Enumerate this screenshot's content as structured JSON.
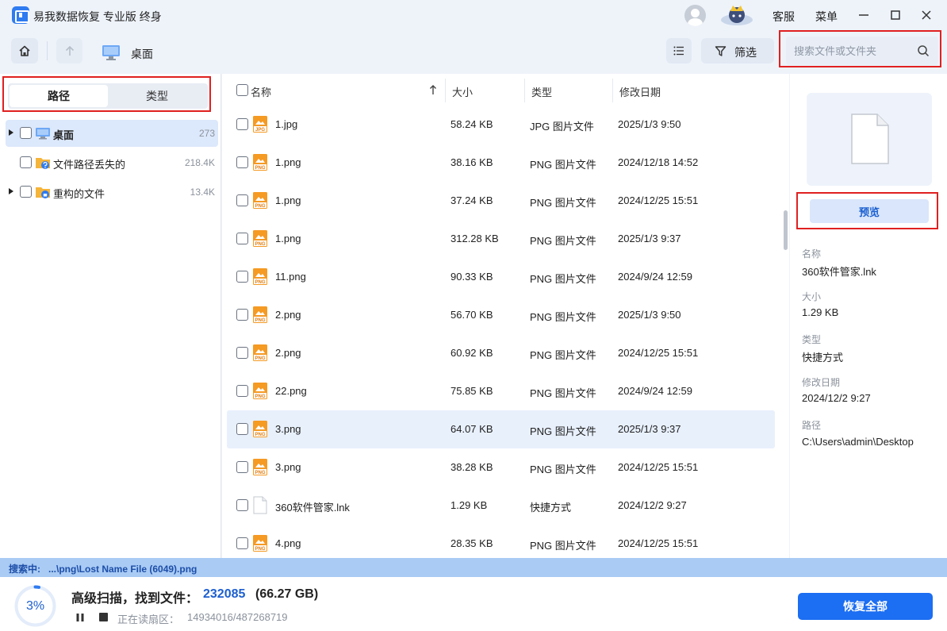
{
  "app": {
    "title": "易我数据恢复 专业版 终身",
    "service_label": "客服",
    "menu_label": "菜单"
  },
  "toolbar": {
    "breadcrumb": "桌面",
    "filter_label": "筛选",
    "search_placeholder": "搜索文件或文件夹"
  },
  "left_tabs": {
    "path": "路径",
    "type": "类型"
  },
  "tree": [
    {
      "label": "桌面",
      "count": "273",
      "expandable": true,
      "selected": true,
      "icon": "desktop-icon"
    },
    {
      "label": "文件路径丢失的",
      "count": "218.4K",
      "expandable": false,
      "selected": false,
      "icon": "folder-lost-icon"
    },
    {
      "label": "重构的文件",
      "count": "13.4K",
      "expandable": true,
      "selected": false,
      "icon": "folder-rebuilt-icon"
    }
  ],
  "columns": {
    "name": "名称",
    "size": "大小",
    "type": "类型",
    "date": "修改日期"
  },
  "files": [
    {
      "name": "1.jpg",
      "size": "58.24 KB",
      "type": "JPG 图片文件",
      "date": "2025/1/3 9:50",
      "kind": "JPG"
    },
    {
      "name": "1.png",
      "size": "38.16 KB",
      "type": "PNG 图片文件",
      "date": "2024/12/18 14:52",
      "kind": "PNG"
    },
    {
      "name": "1.png",
      "size": "37.24 KB",
      "type": "PNG 图片文件",
      "date": "2024/12/25 15:51",
      "kind": "PNG"
    },
    {
      "name": "1.png",
      "size": "312.28 KB",
      "type": "PNG 图片文件",
      "date": "2025/1/3 9:37",
      "kind": "PNG"
    },
    {
      "name": "11.png",
      "size": "90.33 KB",
      "type": "PNG 图片文件",
      "date": "2024/9/24 12:59",
      "kind": "PNG"
    },
    {
      "name": "2.png",
      "size": "56.70 KB",
      "type": "PNG 图片文件",
      "date": "2025/1/3 9:50",
      "kind": "PNG"
    },
    {
      "name": "2.png",
      "size": "60.92 KB",
      "type": "PNG 图片文件",
      "date": "2024/12/25 15:51",
      "kind": "PNG"
    },
    {
      "name": "22.png",
      "size": "75.85 KB",
      "type": "PNG 图片文件",
      "date": "2024/9/24 12:59",
      "kind": "PNG"
    },
    {
      "name": "3.png",
      "size": "64.07 KB",
      "type": "PNG 图片文件",
      "date": "2025/1/3 9:37",
      "kind": "PNG",
      "highlight": true
    },
    {
      "name": "3.png",
      "size": "38.28 KB",
      "type": "PNG 图片文件",
      "date": "2024/12/25 15:51",
      "kind": "PNG"
    },
    {
      "name": "360软件管家.lnk",
      "size": "1.29 KB",
      "type": "快捷方式",
      "date": "2024/12/2 9:27",
      "kind": "LNK"
    },
    {
      "name": "4.png",
      "size": "28.35 KB",
      "type": "PNG 图片文件",
      "date": "2024/12/25 15:51",
      "kind": "PNG"
    }
  ],
  "preview": {
    "button": "预览",
    "name_label": "名称",
    "name": "360软件管家.lnk",
    "size_label": "大小",
    "size": "1.29 KB",
    "type_label": "类型",
    "type": "快捷方式",
    "date_label": "修改日期",
    "date": "2024/12/2 9:27",
    "path_label": "路径",
    "path": "C:\\Users\\admin\\Desktop"
  },
  "status": {
    "searching": "搜索中:   ...\\png\\Lost Name File (6049).png"
  },
  "scan": {
    "percent": "3%",
    "progress": 0.03,
    "label": "高级扫描，找到文件：",
    "count": "232085",
    "size": "(66.27 GB)",
    "sector_label": "正在读扇区：",
    "sector_value": "14934016/487268719",
    "recover_label": "恢复全部"
  },
  "colors": {
    "accent": "#1c6ef2",
    "highlight_box": "#e02020"
  }
}
